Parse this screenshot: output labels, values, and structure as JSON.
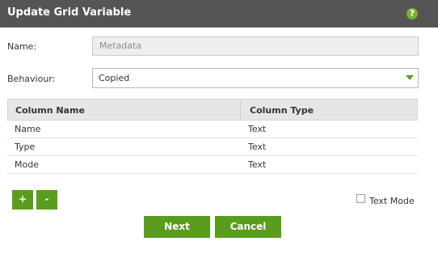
{
  "dialog": {
    "title": "Update Grid Variable",
    "help_icon": "question-icon"
  },
  "form": {
    "name_label": "Name:",
    "name_value": "Metadata",
    "behaviour_label": "Behaviour:",
    "behaviour_value": "Copied"
  },
  "grid": {
    "headers": [
      "Column Name",
      "Column Type"
    ],
    "rows": [
      [
        "Name",
        "Text"
      ],
      [
        "Type",
        "Text"
      ],
      [
        "Mode",
        "Text"
      ]
    ]
  },
  "toolbar": {
    "add_label": "+",
    "remove_label": "-",
    "text_mode_label": "Text Mode",
    "text_mode_checked": false
  },
  "actions": {
    "next_label": "Next",
    "cancel_label": "Cancel"
  },
  "colors": {
    "titlebar": "#555555",
    "accent": "#5a9c1e",
    "help_icon": "#77b32d"
  }
}
